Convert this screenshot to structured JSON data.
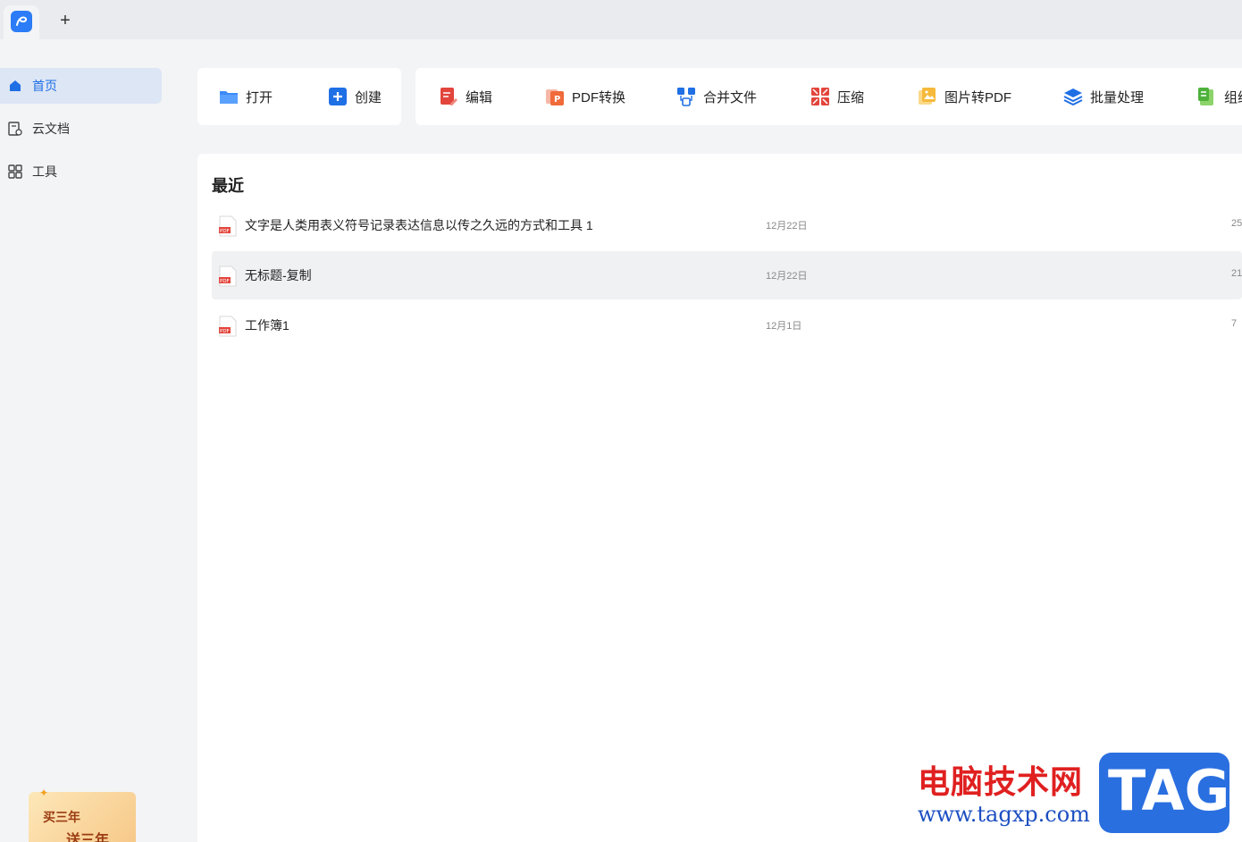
{
  "titlebar": {
    "logo_icon": "app-logo-icon",
    "new_tab_label": "+"
  },
  "sidebar": {
    "items": [
      {
        "label": "首页",
        "icon": "home-icon",
        "active": true
      },
      {
        "label": "云文档",
        "icon": "cloud-doc-icon",
        "active": false
      },
      {
        "label": "工具",
        "icon": "grid-icon",
        "active": false
      }
    ],
    "promo": {
      "line1": "买三年",
      "line2": "送三年"
    }
  },
  "toolbar": {
    "file_actions": [
      {
        "label": "打开",
        "icon": "folder-icon"
      },
      {
        "label": "创建",
        "icon": "plus-square-icon"
      }
    ],
    "tools": [
      {
        "label": "编辑",
        "icon": "edit-doc-icon"
      },
      {
        "label": "PDF转换",
        "icon": "pdf-convert-icon"
      },
      {
        "label": "合并文件",
        "icon": "merge-icon"
      },
      {
        "label": "压缩",
        "icon": "compress-icon"
      },
      {
        "label": "图片转PDF",
        "icon": "image-to-pdf-icon"
      },
      {
        "label": "批量处理",
        "icon": "batch-layers-icon"
      },
      {
        "label": "组织",
        "icon": "organize-icon"
      }
    ]
  },
  "recent": {
    "title": "最近",
    "files": [
      {
        "name": "文字是人类用表义符号记录表达信息以传之久远的方式和工具 1",
        "date": "12月22日",
        "size": "25"
      },
      {
        "name": "无标题-复制",
        "date": "12月22日",
        "size": "21"
      },
      {
        "name": "工作簿1",
        "date": "12月1日",
        "size": "7"
      }
    ]
  },
  "watermark": {
    "line1": "电脑技术网",
    "line2": "www.tagxp.com",
    "badge": "TAG"
  },
  "colors": {
    "accent": "#1f6fe5",
    "sidebar_active_bg": "#dde6f5",
    "pdf_red": "#e2453c"
  }
}
